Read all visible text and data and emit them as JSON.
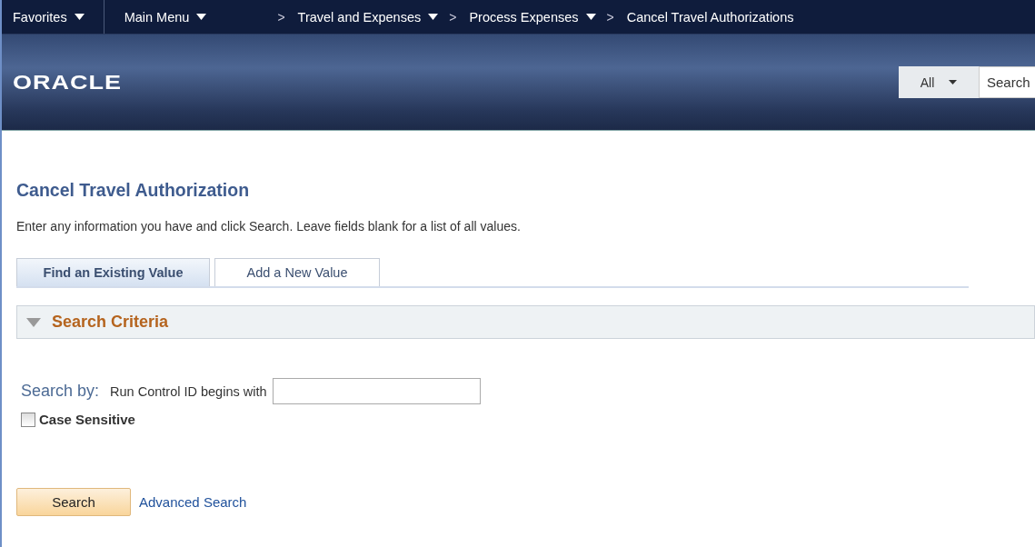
{
  "nav_bar": {
    "menus": [
      {
        "label": "Favorites",
        "has_dropdown": true
      },
      {
        "label": "Main Menu",
        "has_dropdown": true
      }
    ],
    "breadcrumbs": [
      {
        "label": "Travel and Expenses",
        "has_dropdown": true
      },
      {
        "label": "Process Expenses",
        "has_dropdown": true
      },
      {
        "label": "Cancel Travel Authorizations",
        "has_dropdown": false
      }
    ],
    "separator": ">"
  },
  "header": {
    "logo": "ORACLE",
    "search_scope": "All",
    "search": {
      "placeholder": "Search"
    }
  },
  "page": {
    "title": "Cancel Travel Authorization",
    "instructions": "Enter any information you have and click Search. Leave fields blank for a list of all values.",
    "tabs": [
      {
        "label": "Find an Existing Value",
        "selected": true
      },
      {
        "label": "Add a New Value",
        "selected": false
      }
    ],
    "section": {
      "title": "Search Criteria",
      "expanded": true
    },
    "search_by_label": "Search by:",
    "field_label": "Run Control ID begins with",
    "case_sensitive": {
      "label": "Case Sensitive",
      "checked": false
    },
    "search_button": "Search",
    "advanced_link": "Advanced Search"
  }
}
